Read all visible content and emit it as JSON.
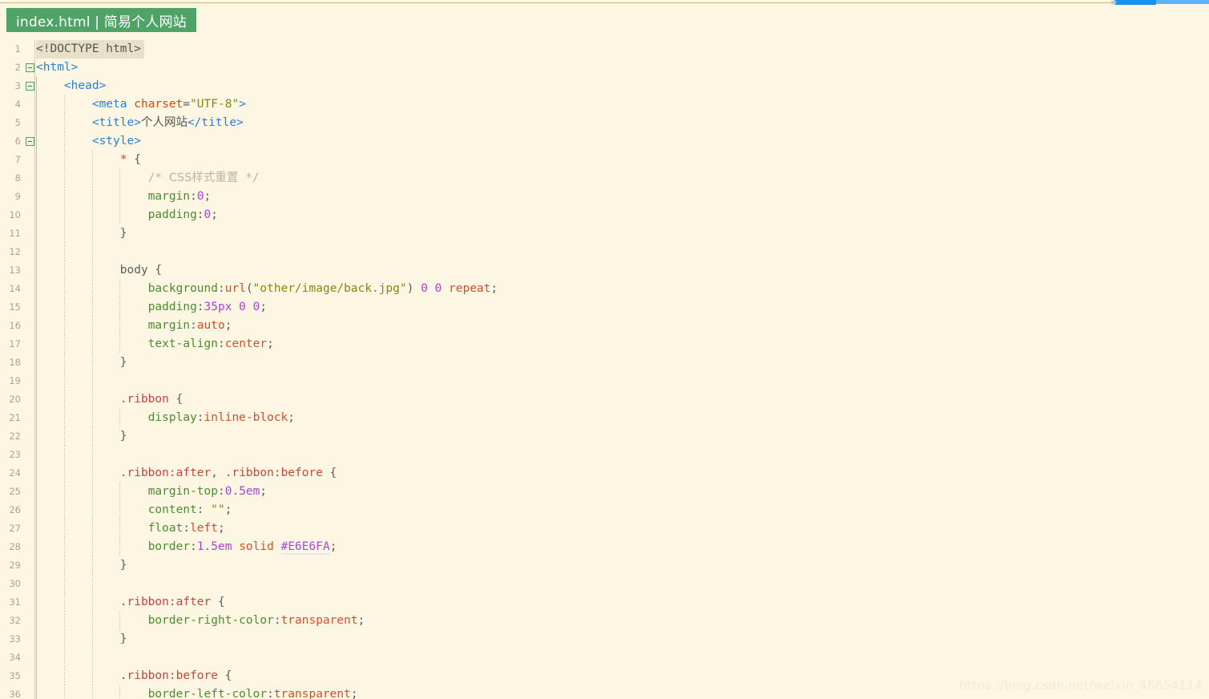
{
  "window": {
    "title_badge": "index.html | 简易个人网站",
    "badge_bg": "#4fa366",
    "badge_fg": "#ffffff",
    "background": "#fdf6e3"
  },
  "scrollbar": {
    "name": "horizontal-scrollbar",
    "thumb_color": "#1a90f0",
    "track_color": "#5cb3f5"
  },
  "watermark": {
    "text": "https://blog.csdn.net/weixin_46654114"
  },
  "editor": {
    "language": "HTML",
    "first_line": 1,
    "last_line": 36,
    "selected_line": 1,
    "fold_lines": [
      2,
      3,
      6
    ],
    "lines": [
      {
        "n": "1",
        "fold": false,
        "guides": [],
        "highlight": true,
        "tokens": [
          {
            "c": "t-doctype",
            "t": "<!DOCTYPE html>"
          }
        ]
      },
      {
        "n": "2",
        "fold": true,
        "guides": [],
        "highlight": false,
        "tokens": [
          {
            "c": "t-tag",
            "t": "<html>"
          }
        ]
      },
      {
        "n": "3",
        "fold": true,
        "guides": [
          0
        ],
        "highlight": false,
        "tokens": [
          {
            "c": "t-plain",
            "t": "    "
          },
          {
            "c": "t-tag",
            "t": "<head>"
          }
        ]
      },
      {
        "n": "4",
        "fold": false,
        "guides": [
          0,
          1
        ],
        "highlight": false,
        "tokens": [
          {
            "c": "t-plain",
            "t": "        "
          },
          {
            "c": "t-tag",
            "t": "<meta "
          },
          {
            "c": "t-attr",
            "t": "charset"
          },
          {
            "c": "t-punct",
            "t": "="
          },
          {
            "c": "t-str",
            "t": "\"UTF-8\""
          },
          {
            "c": "t-tag",
            "t": ">"
          }
        ]
      },
      {
        "n": "5",
        "fold": false,
        "guides": [
          0,
          1
        ],
        "highlight": false,
        "tokens": [
          {
            "c": "t-plain",
            "t": "        "
          },
          {
            "c": "t-tag",
            "t": "<title>"
          },
          {
            "c": "t-cjk",
            "t": "个人网站"
          },
          {
            "c": "t-tag",
            "t": "</title>"
          }
        ]
      },
      {
        "n": "6",
        "fold": true,
        "guides": [
          0,
          1
        ],
        "highlight": false,
        "tokens": [
          {
            "c": "t-plain",
            "t": "        "
          },
          {
            "c": "t-tag",
            "t": "<style>"
          }
        ]
      },
      {
        "n": "7",
        "fold": false,
        "guides": [
          0,
          1,
          2
        ],
        "highlight": false,
        "tokens": [
          {
            "c": "t-plain",
            "t": "            "
          },
          {
            "c": "t-sel",
            "t": "*"
          },
          {
            "c": "t-punct",
            "t": " {"
          }
        ]
      },
      {
        "n": "8",
        "fold": false,
        "guides": [
          0,
          1,
          2,
          3
        ],
        "highlight": false,
        "tokens": [
          {
            "c": "t-plain",
            "t": "                "
          },
          {
            "c": "t-comment",
            "t": "/* "
          },
          {
            "c": "t-cjk-com",
            "t": "CSS样式重置"
          },
          {
            "c": "t-comment",
            "t": " */"
          }
        ]
      },
      {
        "n": "9",
        "fold": false,
        "guides": [
          0,
          1,
          2,
          3
        ],
        "highlight": false,
        "tokens": [
          {
            "c": "t-plain",
            "t": "                "
          },
          {
            "c": "t-prop",
            "t": "margin"
          },
          {
            "c": "t-punct",
            "t": ":"
          },
          {
            "c": "t-num",
            "t": "0"
          },
          {
            "c": "t-punct",
            "t": ";"
          }
        ]
      },
      {
        "n": "10",
        "fold": false,
        "guides": [
          0,
          1,
          2,
          3
        ],
        "highlight": false,
        "tokens": [
          {
            "c": "t-plain",
            "t": "                "
          },
          {
            "c": "t-prop",
            "t": "padding"
          },
          {
            "c": "t-punct",
            "t": ":"
          },
          {
            "c": "t-num",
            "t": "0"
          },
          {
            "c": "t-punct",
            "t": ";"
          }
        ]
      },
      {
        "n": "11",
        "fold": false,
        "guides": [
          0,
          1,
          2
        ],
        "highlight": false,
        "tokens": [
          {
            "c": "t-plain",
            "t": "            "
          },
          {
            "c": "t-punct",
            "t": "}"
          }
        ]
      },
      {
        "n": "12",
        "fold": false,
        "guides": [
          0,
          1,
          2
        ],
        "highlight": false,
        "tokens": []
      },
      {
        "n": "13",
        "fold": false,
        "guides": [
          0,
          1,
          2
        ],
        "highlight": false,
        "tokens": [
          {
            "c": "t-plain",
            "t": "            "
          },
          {
            "c": "t-punct",
            "t": "body {"
          }
        ]
      },
      {
        "n": "14",
        "fold": false,
        "guides": [
          0,
          1,
          2,
          3
        ],
        "highlight": false,
        "tokens": [
          {
            "c": "t-plain",
            "t": "                "
          },
          {
            "c": "t-prop",
            "t": "background"
          },
          {
            "c": "t-punct",
            "t": ":"
          },
          {
            "c": "t-val",
            "t": "url"
          },
          {
            "c": "t-punct",
            "t": "("
          },
          {
            "c": "t-str",
            "t": "\"other/image/back.jpg\""
          },
          {
            "c": "t-punct",
            "t": ") "
          },
          {
            "c": "t-num",
            "t": "0 0"
          },
          {
            "c": "t-punct",
            "t": " "
          },
          {
            "c": "t-val",
            "t": "repeat"
          },
          {
            "c": "t-punct",
            "t": ";"
          }
        ]
      },
      {
        "n": "15",
        "fold": false,
        "guides": [
          0,
          1,
          2,
          3
        ],
        "highlight": false,
        "tokens": [
          {
            "c": "t-plain",
            "t": "                "
          },
          {
            "c": "t-prop",
            "t": "padding"
          },
          {
            "c": "t-punct",
            "t": ":"
          },
          {
            "c": "t-num",
            "t": "35px 0 0"
          },
          {
            "c": "t-punct",
            "t": ";"
          }
        ]
      },
      {
        "n": "16",
        "fold": false,
        "guides": [
          0,
          1,
          2,
          3
        ],
        "highlight": false,
        "tokens": [
          {
            "c": "t-plain",
            "t": "                "
          },
          {
            "c": "t-prop",
            "t": "margin"
          },
          {
            "c": "t-punct",
            "t": ":"
          },
          {
            "c": "t-val",
            "t": "auto"
          },
          {
            "c": "t-punct",
            "t": ";"
          }
        ]
      },
      {
        "n": "17",
        "fold": false,
        "guides": [
          0,
          1,
          2,
          3
        ],
        "highlight": false,
        "tokens": [
          {
            "c": "t-plain",
            "t": "                "
          },
          {
            "c": "t-prop",
            "t": "text-align"
          },
          {
            "c": "t-punct",
            "t": ":"
          },
          {
            "c": "t-val",
            "t": "center"
          },
          {
            "c": "t-punct",
            "t": ";"
          }
        ]
      },
      {
        "n": "18",
        "fold": false,
        "guides": [
          0,
          1,
          2
        ],
        "highlight": false,
        "tokens": [
          {
            "c": "t-plain",
            "t": "            "
          },
          {
            "c": "t-punct",
            "t": "}"
          }
        ]
      },
      {
        "n": "19",
        "fold": false,
        "guides": [
          0,
          1,
          2
        ],
        "highlight": false,
        "tokens": []
      },
      {
        "n": "20",
        "fold": false,
        "guides": [
          0,
          1,
          2
        ],
        "highlight": false,
        "tokens": [
          {
            "c": "t-plain",
            "t": "            "
          },
          {
            "c": "t-sel",
            "t": ".ribbon"
          },
          {
            "c": "t-punct",
            "t": " {"
          }
        ]
      },
      {
        "n": "21",
        "fold": false,
        "guides": [
          0,
          1,
          2,
          3
        ],
        "highlight": false,
        "tokens": [
          {
            "c": "t-plain",
            "t": "                "
          },
          {
            "c": "t-prop",
            "t": "display"
          },
          {
            "c": "t-punct",
            "t": ":"
          },
          {
            "c": "t-val",
            "t": "inline-block"
          },
          {
            "c": "t-punct",
            "t": ";"
          }
        ]
      },
      {
        "n": "22",
        "fold": false,
        "guides": [
          0,
          1,
          2
        ],
        "highlight": false,
        "tokens": [
          {
            "c": "t-plain",
            "t": "            "
          },
          {
            "c": "t-punct",
            "t": "}"
          }
        ]
      },
      {
        "n": "23",
        "fold": false,
        "guides": [
          0,
          1,
          2
        ],
        "highlight": false,
        "tokens": []
      },
      {
        "n": "24",
        "fold": false,
        "guides": [
          0,
          1,
          2
        ],
        "highlight": false,
        "tokens": [
          {
            "c": "t-plain",
            "t": "            "
          },
          {
            "c": "t-sel",
            "t": ".ribbon:after"
          },
          {
            "c": "t-punct",
            "t": ", "
          },
          {
            "c": "t-sel",
            "t": ".ribbon:before"
          },
          {
            "c": "t-punct",
            "t": " {"
          }
        ]
      },
      {
        "n": "25",
        "fold": false,
        "guides": [
          0,
          1,
          2,
          3
        ],
        "highlight": false,
        "tokens": [
          {
            "c": "t-plain",
            "t": "                "
          },
          {
            "c": "t-prop",
            "t": "margin-top"
          },
          {
            "c": "t-punct",
            "t": ":"
          },
          {
            "c": "t-num",
            "t": "0.5em"
          },
          {
            "c": "t-punct",
            "t": ";"
          }
        ]
      },
      {
        "n": "26",
        "fold": false,
        "guides": [
          0,
          1,
          2,
          3
        ],
        "highlight": false,
        "tokens": [
          {
            "c": "t-plain",
            "t": "                "
          },
          {
            "c": "t-prop",
            "t": "content"
          },
          {
            "c": "t-punct",
            "t": ": "
          },
          {
            "c": "t-str",
            "t": "\"\""
          },
          {
            "c": "t-punct",
            "t": ";"
          }
        ]
      },
      {
        "n": "27",
        "fold": false,
        "guides": [
          0,
          1,
          2,
          3
        ],
        "highlight": false,
        "tokens": [
          {
            "c": "t-plain",
            "t": "                "
          },
          {
            "c": "t-prop",
            "t": "float"
          },
          {
            "c": "t-punct",
            "t": ":"
          },
          {
            "c": "t-val",
            "t": "left"
          },
          {
            "c": "t-punct",
            "t": ";"
          }
        ]
      },
      {
        "n": "28",
        "fold": false,
        "guides": [
          0,
          1,
          2,
          3
        ],
        "highlight": false,
        "tokens": [
          {
            "c": "t-plain",
            "t": "                "
          },
          {
            "c": "t-prop",
            "t": "border"
          },
          {
            "c": "t-punct",
            "t": ":"
          },
          {
            "c": "t-num",
            "t": "1.5em"
          },
          {
            "c": "t-punct",
            "t": " "
          },
          {
            "c": "t-val",
            "t": "solid"
          },
          {
            "c": "t-punct",
            "t": " "
          },
          {
            "c": "t-hex",
            "t": "#E6E6FA"
          },
          {
            "c": "t-punct",
            "t": ";"
          }
        ]
      },
      {
        "n": "29",
        "fold": false,
        "guides": [
          0,
          1,
          2
        ],
        "highlight": false,
        "tokens": [
          {
            "c": "t-plain",
            "t": "            "
          },
          {
            "c": "t-punct",
            "t": "}"
          }
        ]
      },
      {
        "n": "30",
        "fold": false,
        "guides": [
          0,
          1,
          2
        ],
        "highlight": false,
        "tokens": []
      },
      {
        "n": "31",
        "fold": false,
        "guides": [
          0,
          1,
          2
        ],
        "highlight": false,
        "tokens": [
          {
            "c": "t-plain",
            "t": "            "
          },
          {
            "c": "t-sel",
            "t": ".ribbon:after"
          },
          {
            "c": "t-punct",
            "t": " {"
          }
        ]
      },
      {
        "n": "32",
        "fold": false,
        "guides": [
          0,
          1,
          2,
          3
        ],
        "highlight": false,
        "tokens": [
          {
            "c": "t-plain",
            "t": "                "
          },
          {
            "c": "t-prop",
            "t": "border-right-color"
          },
          {
            "c": "t-punct",
            "t": ":"
          },
          {
            "c": "t-val",
            "t": "transparent"
          },
          {
            "c": "t-punct",
            "t": ";"
          }
        ]
      },
      {
        "n": "33",
        "fold": false,
        "guides": [
          0,
          1,
          2
        ],
        "highlight": false,
        "tokens": [
          {
            "c": "t-plain",
            "t": "            "
          },
          {
            "c": "t-punct",
            "t": "}"
          }
        ]
      },
      {
        "n": "34",
        "fold": false,
        "guides": [
          0,
          1,
          2
        ],
        "highlight": false,
        "tokens": []
      },
      {
        "n": "35",
        "fold": false,
        "guides": [
          0,
          1,
          2
        ],
        "highlight": false,
        "tokens": [
          {
            "c": "t-plain",
            "t": "            "
          },
          {
            "c": "t-sel",
            "t": ".ribbon:before"
          },
          {
            "c": "t-punct",
            "t": " {"
          }
        ]
      },
      {
        "n": "36",
        "fold": false,
        "guides": [
          0,
          1,
          2,
          3
        ],
        "highlight": false,
        "tokens": [
          {
            "c": "t-plain",
            "t": "                "
          },
          {
            "c": "t-prop",
            "t": "border-left-color"
          },
          {
            "c": "t-punct",
            "t": ":"
          },
          {
            "c": "t-val",
            "t": "transparent"
          },
          {
            "c": "t-punct",
            "t": ";"
          }
        ]
      }
    ]
  }
}
